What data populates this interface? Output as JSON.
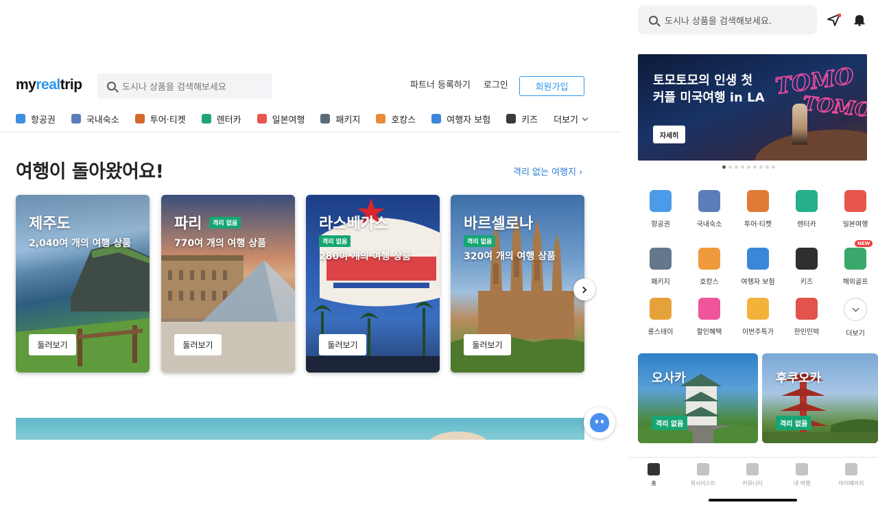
{
  "desktop": {
    "logo": {
      "part1": "my",
      "part2": "real",
      "part3": "trip"
    },
    "search": {
      "placeholder": "도시나 상품을 검색해보세요"
    },
    "header_links": [
      "파트너 등록하기",
      "로그인"
    ],
    "signup_label": "회원가입",
    "categories": [
      {
        "label": "항공권",
        "icon": "airplane-icon",
        "color": "#3d8fe0"
      },
      {
        "label": "국내숙소",
        "icon": "house-icon",
        "color": "#5b7db8"
      },
      {
        "label": "투어·티켓",
        "icon": "tour-icon",
        "color": "#d2692e"
      },
      {
        "label": "렌터카",
        "icon": "car-icon",
        "color": "#1fa37a"
      },
      {
        "label": "일본여행",
        "icon": "japan-icon",
        "color": "#e8554c"
      },
      {
        "label": "패키지",
        "icon": "luggage-icon",
        "color": "#5c6b7a"
      },
      {
        "label": "호캉스",
        "icon": "hotel-icon",
        "color": "#e88c3a"
      },
      {
        "label": "여행자 보험",
        "icon": "insurance-icon",
        "color": "#3b86d9"
      },
      {
        "label": "키즈",
        "icon": "kids-icon",
        "color": "#3a3a3a"
      }
    ],
    "more_label": "더보기",
    "heading": "여행이 돌아왔어요!",
    "more_link": "격리 없는 여행지 ›",
    "cards": [
      {
        "city": "제주도",
        "badge": "",
        "subtitle": "2,040여 개의 여행 상품",
        "button": "둘러보기"
      },
      {
        "city": "파리",
        "badge": "격리 없음",
        "subtitle": "770여 개의 여행 상품",
        "button": "둘러보기"
      },
      {
        "city": "라스베가스",
        "badge": "격리 없음",
        "subtitle": "280여 개의 여행 상품",
        "button": "둘러보기"
      },
      {
        "city": "바르셀로나",
        "badge": "격리 없음",
        "subtitle": "320여 개의 여행 상품",
        "button": "둘러보기"
      }
    ]
  },
  "mobile": {
    "search": {
      "placeholder": "도시나 상품을 검색해보세요."
    },
    "banner": {
      "line1": "토모토모의 인생 첫",
      "line2": "커플 미국여행 in LA",
      "button": "자세히"
    },
    "carousel": {
      "count": 9,
      "active": 0
    },
    "quick_menu": [
      {
        "label": "항공권",
        "icon": "airplane-icon",
        "color": "#4a9be8"
      },
      {
        "label": "국내숙소",
        "icon": "house-icon",
        "color": "#5b7db8"
      },
      {
        "label": "투어·티켓",
        "icon": "tour-icon",
        "color": "#e07b35"
      },
      {
        "label": "렌터카",
        "icon": "car-icon",
        "color": "#25b08a"
      },
      {
        "label": "일본여행",
        "icon": "japan-icon",
        "color": "#e8554c"
      },
      {
        "label": "패키지",
        "icon": "luggage-icon",
        "color": "#64788c"
      },
      {
        "label": "호캉스",
        "icon": "hotel-icon",
        "color": "#f09a3e"
      },
      {
        "label": "여행자 보험",
        "icon": "insurance-icon",
        "color": "#3b86d9"
      },
      {
        "label": "키즈",
        "icon": "kids-icon",
        "color": "#2f2f2f"
      },
      {
        "label": "해외골프",
        "icon": "golf-icon",
        "color": "#3aa86b",
        "new": "NEW"
      },
      {
        "label": "롱스테이",
        "icon": "longstay-icon",
        "color": "#e6a23a"
      },
      {
        "label": "할인혜택",
        "icon": "discount-icon",
        "color": "#f0559c"
      },
      {
        "label": "이번주특가",
        "icon": "deal-icon",
        "color": "#f3b33b"
      },
      {
        "label": "한인민박",
        "icon": "minbak-icon",
        "color": "#e2534c"
      },
      {
        "label": "더보기",
        "icon": "chevron-down-icon",
        "color": "#333333"
      }
    ],
    "cards": [
      {
        "city": "오사카",
        "badge": "격리 없음"
      },
      {
        "city": "후쿠오카",
        "badge": "격리 없음"
      }
    ],
    "tabs": [
      {
        "label": "홈",
        "icon": "home-icon",
        "active": true
      },
      {
        "label": "위시리스트",
        "icon": "heart-icon",
        "active": false
      },
      {
        "label": "커뮤니티",
        "icon": "community-icon",
        "active": false
      },
      {
        "label": "내 여행",
        "icon": "suitcase-icon",
        "active": false
      },
      {
        "label": "마이페이지",
        "icon": "profile-icon",
        "active": false
      }
    ]
  }
}
